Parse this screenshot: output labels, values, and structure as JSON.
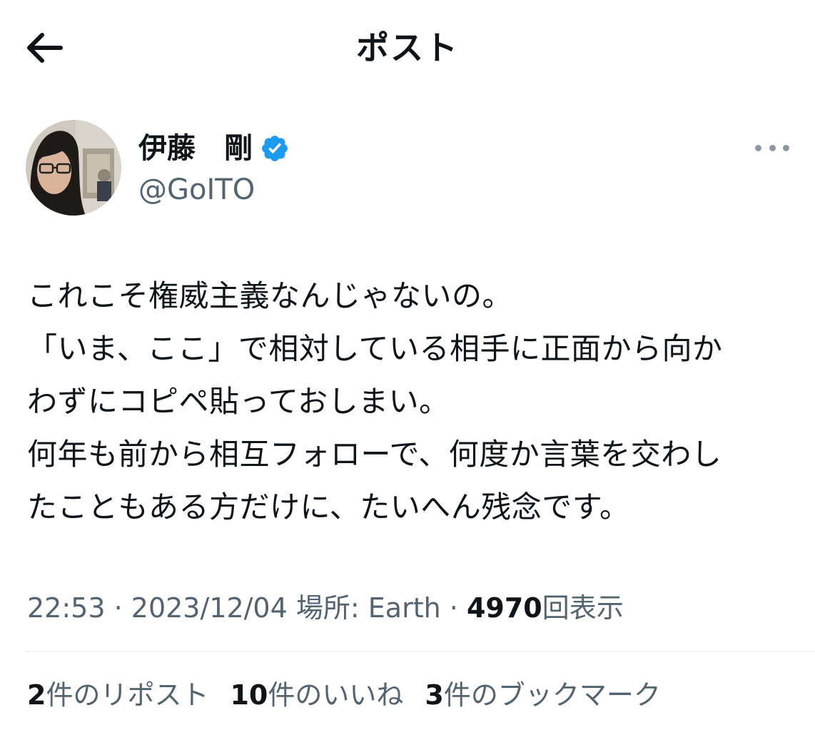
{
  "header": {
    "title": "ポスト",
    "back_icon": "arrow-left-icon"
  },
  "author": {
    "display_name": "伊藤　剛",
    "handle": "@GoITO",
    "verified_icon": "verified-badge-icon",
    "badge_color": "#1d9bf0",
    "more_icon": "more-horizontal-icon"
  },
  "tweet": {
    "lines": [
      "これこそ権威主義なんじゃないの。",
      "「いま、ここ」で相対している相手に正面から向か",
      "わずにコピペ貼っておしまい。",
      "何年も前から相互フォローで、何度か言葉を交わし",
      "たこともある方だけに、たいへん残念です。"
    ]
  },
  "meta": {
    "time": "22:53",
    "separator": " · ",
    "date": "2023/12/04",
    "location_label": "場所: Earth",
    "views_count": "4970",
    "views_label": "回表示"
  },
  "stats": {
    "reposts_count": "2",
    "reposts_label": "件のリポスト",
    "likes_count": "10",
    "likes_label": "件のいいね",
    "bookmarks_count": "3",
    "bookmarks_label": "件のブックマーク"
  }
}
